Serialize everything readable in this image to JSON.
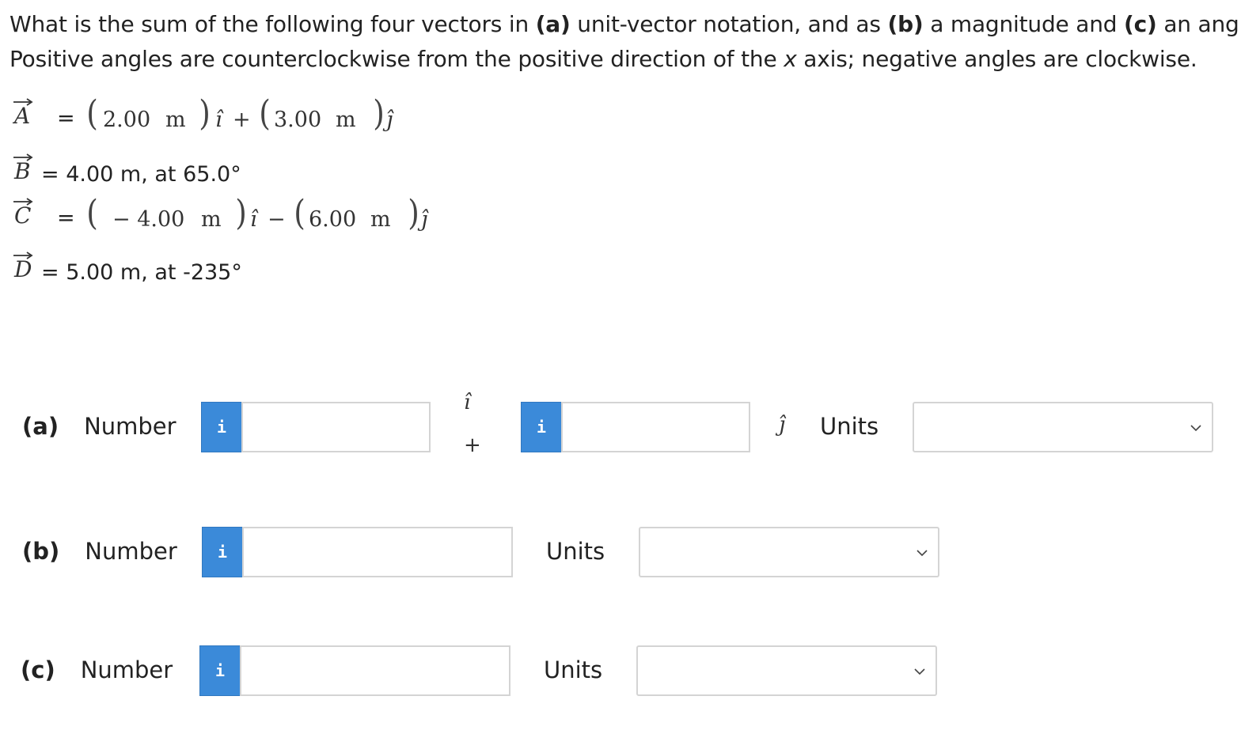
{
  "question": {
    "line1_parts": [
      {
        "t": "What is the sum of the following four vectors in ",
        "b": false
      },
      {
        "t": "(a)",
        "b": true
      },
      {
        "t": " unit-vector notation, and as ",
        "b": false
      },
      {
        "t": "(b)",
        "b": true
      },
      {
        "t": " a magnitude and ",
        "b": false
      },
      {
        "t": "(c)",
        "b": true
      },
      {
        "t": " an angle?",
        "b": false
      }
    ],
    "line2_before": "Positive angles are counterclockwise from the positive direction of the ",
    "line2_italic": "x",
    "line2_after": " axis; negative angles are clockwise."
  },
  "vectors": {
    "A": {
      "letter": "A",
      "eq": "=",
      "c1": "2.00",
      "u1": "m",
      "i_hat": "î",
      "op": "+",
      "c2": "3.00",
      "u2": "m",
      "j_hat": "ĵ"
    },
    "B": {
      "letter": "B",
      "text": "= 4.00 m, at 65.0°"
    },
    "C": {
      "letter": "C",
      "eq": "=",
      "c1": "− 4.00",
      "u1": "m",
      "i_hat": "î",
      "op": "−",
      "c2": "6.00",
      "u2": "m",
      "j_hat": "ĵ"
    },
    "D": {
      "letter": "D",
      "text": "= 5.00 m, at -235°"
    }
  },
  "answers": {
    "a": {
      "part": "(a)",
      "label": "Number",
      "info": "i",
      "i_hat": "î",
      "plus": "+",
      "j_hat": "ĵ",
      "units_label": "Units",
      "value_i": "",
      "value_j": "",
      "units_value": ""
    },
    "b": {
      "part": "(b)",
      "label": "Number",
      "info": "i",
      "units_label": "Units",
      "value": "",
      "units_value": ""
    },
    "c": {
      "part": "(c)",
      "label": "Number",
      "info": "i",
      "units_label": "Units",
      "value": "",
      "units_value": ""
    }
  },
  "colors": {
    "info_button": "#3b8ad9",
    "input_border": "#d4d4d4",
    "text": "#222222"
  },
  "icons": {
    "info": "info-icon",
    "dropdown": "chevron-down-icon"
  }
}
